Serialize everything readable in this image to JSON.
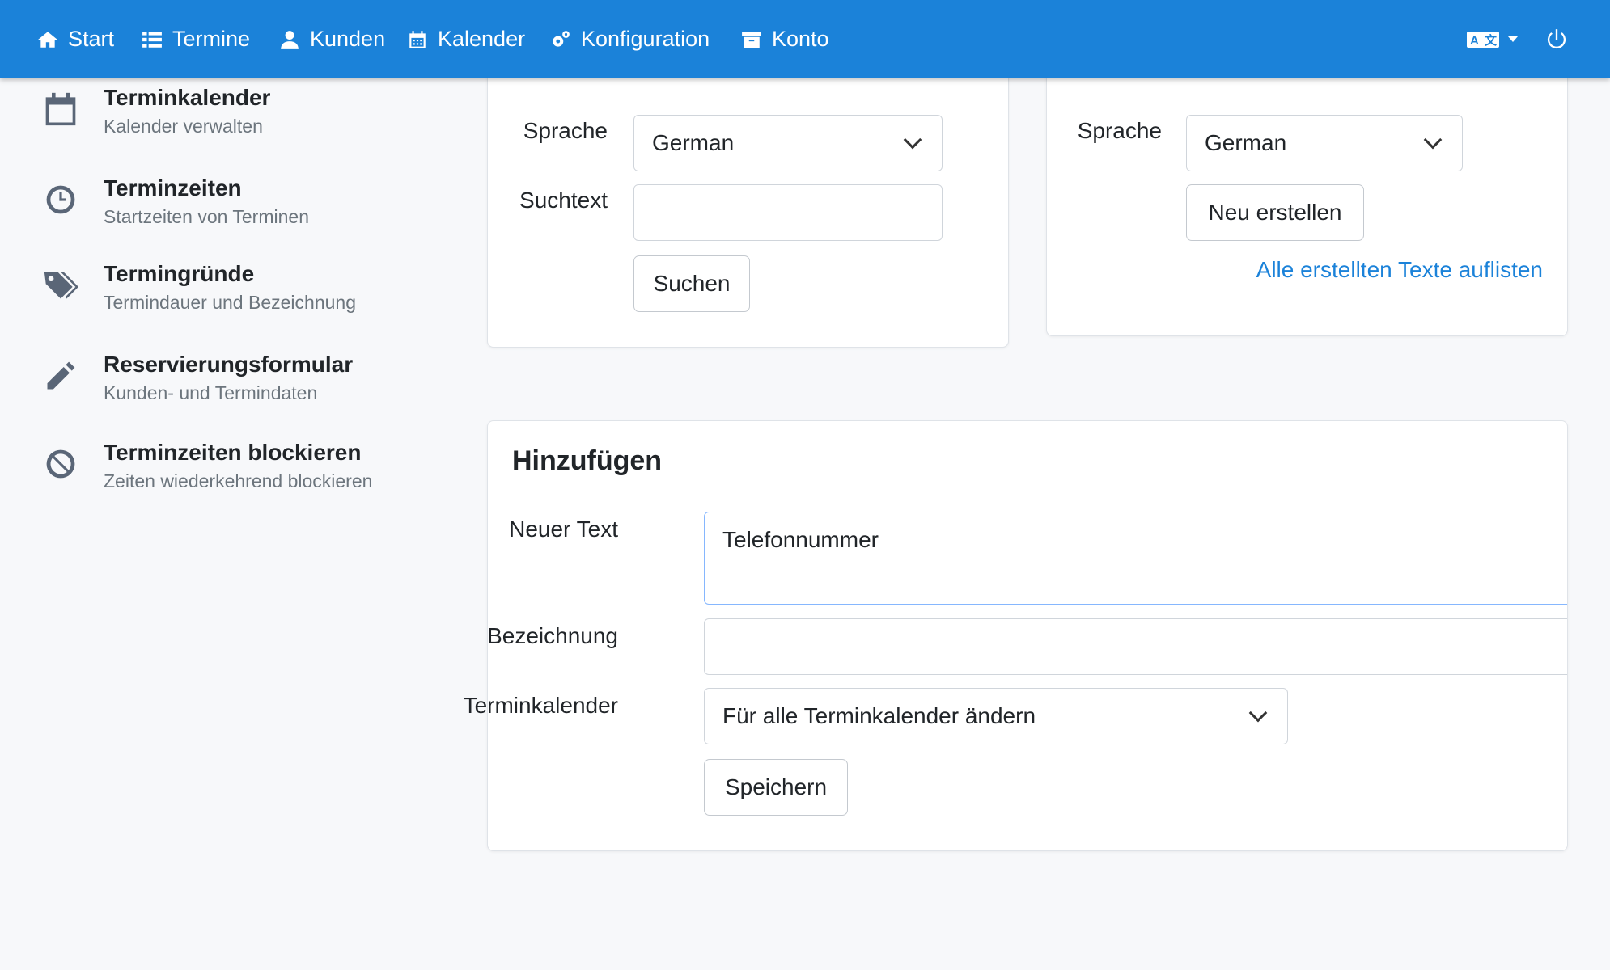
{
  "nav": {
    "items": [
      {
        "label": "Start",
        "icon": "home-icon"
      },
      {
        "label": "Termine",
        "icon": "list-icon"
      },
      {
        "label": "Kunden",
        "icon": "user-icon"
      },
      {
        "label": "Kalender",
        "icon": "calendar-icon"
      },
      {
        "label": "Konfiguration",
        "icon": "cogs-icon"
      },
      {
        "label": "Konto",
        "icon": "archive-icon"
      }
    ],
    "right_icons": [
      "language-icon",
      "power-icon"
    ]
  },
  "sidebar": {
    "items": [
      {
        "title": "Terminkalender",
        "sub": "Kalender verwalten",
        "icon": "calendar-icon"
      },
      {
        "title": "Terminzeiten",
        "sub": "Startzeiten von Terminen",
        "icon": "clock-icon"
      },
      {
        "title": "Termingründe",
        "sub": "Termindauer und Bezeichnung",
        "icon": "tags-icon"
      },
      {
        "title": "Reservierungsformular",
        "sub": "Kunden- und Termindaten",
        "icon": "pencil-icon"
      },
      {
        "title": "Terminzeiten blockieren",
        "sub": "Zeiten wiederkehrend blockieren",
        "icon": "ban-icon"
      }
    ]
  },
  "search_card": {
    "language_label": "Sprache",
    "language_value": "German",
    "search_label": "Suchtext",
    "search_value": "",
    "search_button": "Suchen"
  },
  "create_card": {
    "language_label": "Sprache",
    "language_value": "German",
    "create_button": "Neu erstellen",
    "list_link": "Alle erstellten Texte auflisten"
  },
  "add_card": {
    "title": "Hinzufügen",
    "new_text_label": "Neuer Text",
    "new_text_value": "Telefonnummer",
    "name_label": "Bezeichnung",
    "name_value": "",
    "calendar_label": "Terminkalender",
    "calendar_value": "Für alle Terminkalender ändern",
    "save_button": "Speichern"
  },
  "colors": {
    "navbar": "#1b82d9",
    "link": "#1b82d9",
    "background": "#f7f8fa"
  }
}
